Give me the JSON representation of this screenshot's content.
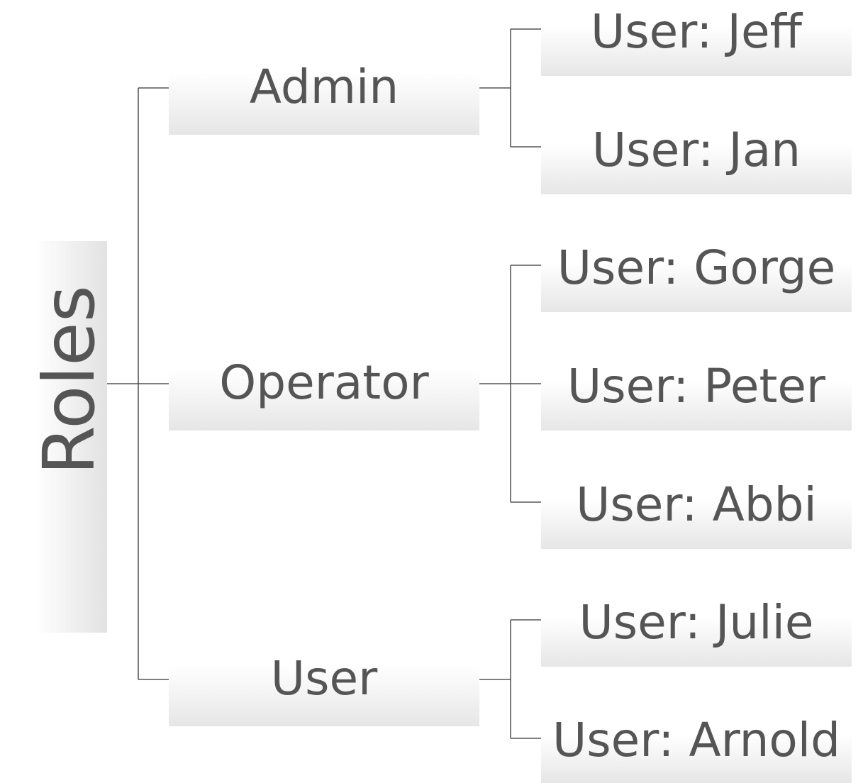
{
  "root": {
    "label": "Roles"
  },
  "roles": [
    {
      "label": "Admin",
      "users": [
        "User: Jeff",
        "User: Jan"
      ]
    },
    {
      "label": "Operator",
      "users": [
        "User: Gorge",
        "User: Peter",
        "User: Abbi"
      ]
    },
    {
      "label": "User",
      "users": [
        "User: Julie",
        "User: Arnold"
      ]
    }
  ],
  "colors": {
    "text": "#555555",
    "line": "#333333",
    "box_gradient_end": "#e6e6e6"
  }
}
